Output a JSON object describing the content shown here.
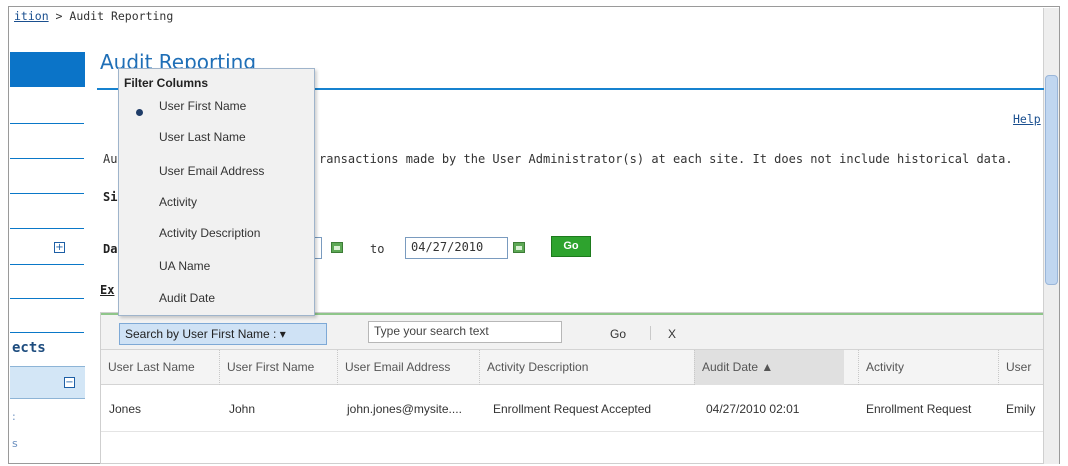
{
  "breadcrumb": {
    "parent": "ition",
    "separator": " > ",
    "current": "Audit Reporting"
  },
  "left_nav": {
    "section_label": "ects",
    "expand_symbol": "+",
    "collapse_symbol": "−",
    "fragments": [
      ":",
      "s"
    ]
  },
  "page": {
    "title": "Audit Reporting",
    "help_link": "Help",
    "description_start": "Au",
    "description": "ransactions made by the User Administrator(s) at each site. It does not include historical data.",
    "site_label": "Si",
    "date_label": "Da",
    "export_label": "Ex",
    "to_label": "to",
    "end_date": "04/27/2010",
    "go_button": "Go"
  },
  "filter_popup": {
    "title": "Filter Columns",
    "selected_index": 0,
    "items": [
      "User First Name",
      "User Last Name",
      "User Email Address",
      "Activity",
      "Activity Description",
      "UA Name",
      "Audit Date"
    ]
  },
  "grid": {
    "search_by_label": "Search by User First Name :",
    "search_placeholder": "Type your search text",
    "go_label": "Go",
    "clear_label": "X",
    "columns": [
      "User Last Name",
      "User First Name",
      "User Email Address",
      "Activity Description",
      "Audit Date ▲",
      "Activity",
      "User"
    ],
    "rows": [
      [
        "Jones",
        "John",
        "john.jones@mysite....",
        "Enrollment Request Accepted",
        "04/27/2010 02:01",
        "Enrollment Request",
        "Emily"
      ]
    ]
  },
  "colors": {
    "accent": "#1f6fb7",
    "go_button": "#2ea32e",
    "nav_active": "#0b74c8"
  }
}
